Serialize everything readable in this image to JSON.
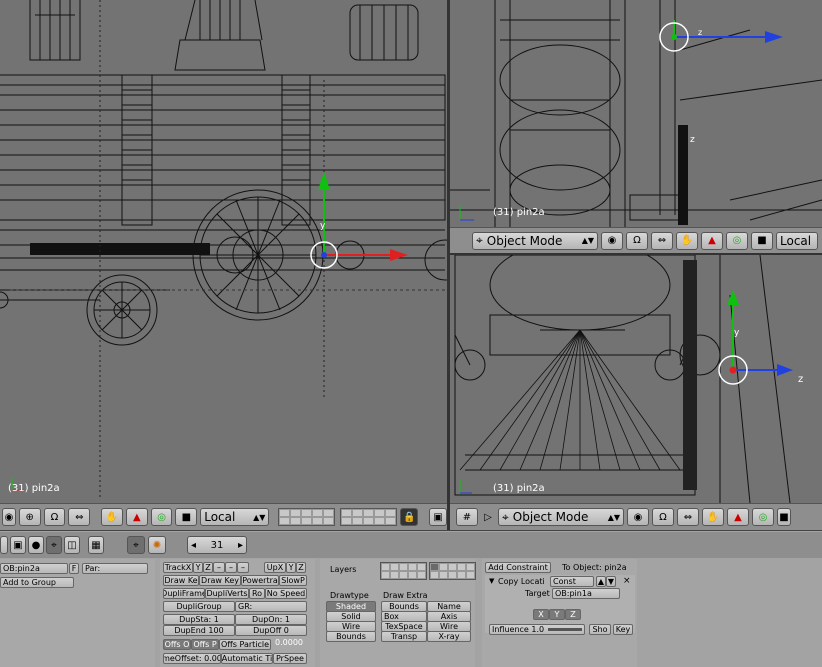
{
  "viewports": {
    "main": {
      "label": "(31) pin2a"
    },
    "top_right": {
      "label": "(31) pin2a"
    },
    "bottom_right": {
      "label": "(31) pin2a"
    }
  },
  "axes": {
    "x": "x",
    "y": "y",
    "z": "z"
  },
  "header_top_right": {
    "mode": "Object Mode",
    "orientation": "Local"
  },
  "header_bottom_left": {
    "orientation": "Local"
  },
  "header_bottom_right": {
    "mode": "Object Mode"
  },
  "buttons_header": {
    "frame": "31"
  },
  "object_panel": {
    "ob_name": "OB:pin2a",
    "f_label": "F",
    "par_label": "Par:",
    "add_to_group": "Add to Group"
  },
  "anim_panel": {
    "trackx": "TrackX",
    "y": "Y",
    "z": "Z",
    "minus1": "–",
    "minus2": "–",
    "minus3": "–",
    "upx": "UpX",
    "upy": "Y",
    "upz": "Z",
    "draw_key": "Draw Ke",
    "draw_key2": "Draw Key",
    "powertrack": "Powertra",
    "slowpar": "SlowP",
    "dupliframes": "DupliFrame",
    "dupliverts": "DupliVerts",
    "rot": "Ro",
    "nospeed": "No Speed",
    "dupligroup": "DupliGroup",
    "gr": "GR:",
    "dupsta": "DupSta: 1",
    "dupon": "DupOn: 1",
    "dupend": "DupEnd 100",
    "dupoff": "DupOff 0",
    "offsob": "Offs O",
    "offspar": "Offs P",
    "offsparticle": "Offs Particle",
    "offsval": "0.0000",
    "timeoffset": "meOffset: 0.00",
    "automatic": "Automatic Ti",
    "prspeed": "PrSpee"
  },
  "draw_panel": {
    "layers_label": "Layers",
    "drawtype_label": "Drawtype",
    "drawextra_label": "Draw Extra",
    "shaded": "Shaded",
    "solid": "Solid",
    "wire": "Wire",
    "bounds": "Bounds",
    "bounds2": "Bounds",
    "box": "Box",
    "texspace": "TexSpace",
    "transp": "Transp",
    "name": "Name",
    "axis": "Axis",
    "wire2": "Wire",
    "xray": "X-ray"
  },
  "constraints_panel": {
    "add_constraint": "Add Constraint",
    "to_object": "To Object: pin2a",
    "copy_location": "Copy Locati",
    "const": "Const",
    "target_label": "Target",
    "target_value": "OB:pin1a",
    "x": "X",
    "y": "Y",
    "z": "Z",
    "influence": "Influence 1.0",
    "show": "Sho",
    "key": "Key"
  },
  "colors": {
    "viewport": "#737373",
    "header": "#8e8e8e",
    "panel": "#a8a8a8",
    "axis_x": "#e02020",
    "axis_y": "#10c010",
    "axis_z": "#2040e0"
  }
}
